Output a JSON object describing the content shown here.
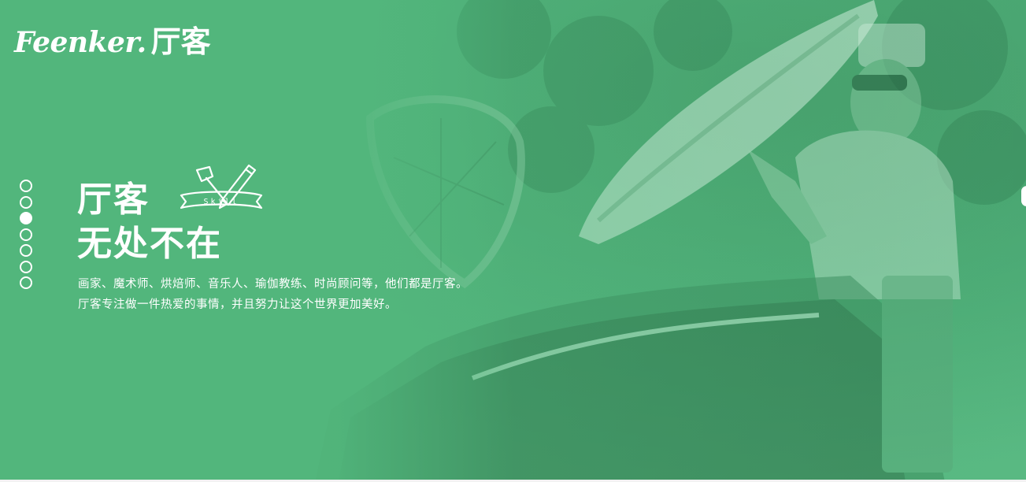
{
  "brand": {
    "logo_latin": "Feenker.",
    "logo_cn": "厅客"
  },
  "hero": {
    "title_line1": "厅客",
    "title_line2": "无处不在",
    "badge_text": "Skill",
    "desc_line1": "画家、魔术师、烘焙师、音乐人、瑜伽教练、时尚顾问等，他们都是厅客。",
    "desc_line2": "厅客专注做一件热爱的事情，并且努力让这个世界更加美好。"
  },
  "slider": {
    "count": 7,
    "active_index": 2
  },
  "colors": {
    "accent_green": "#4fb57c",
    "text": "#ffffff"
  }
}
